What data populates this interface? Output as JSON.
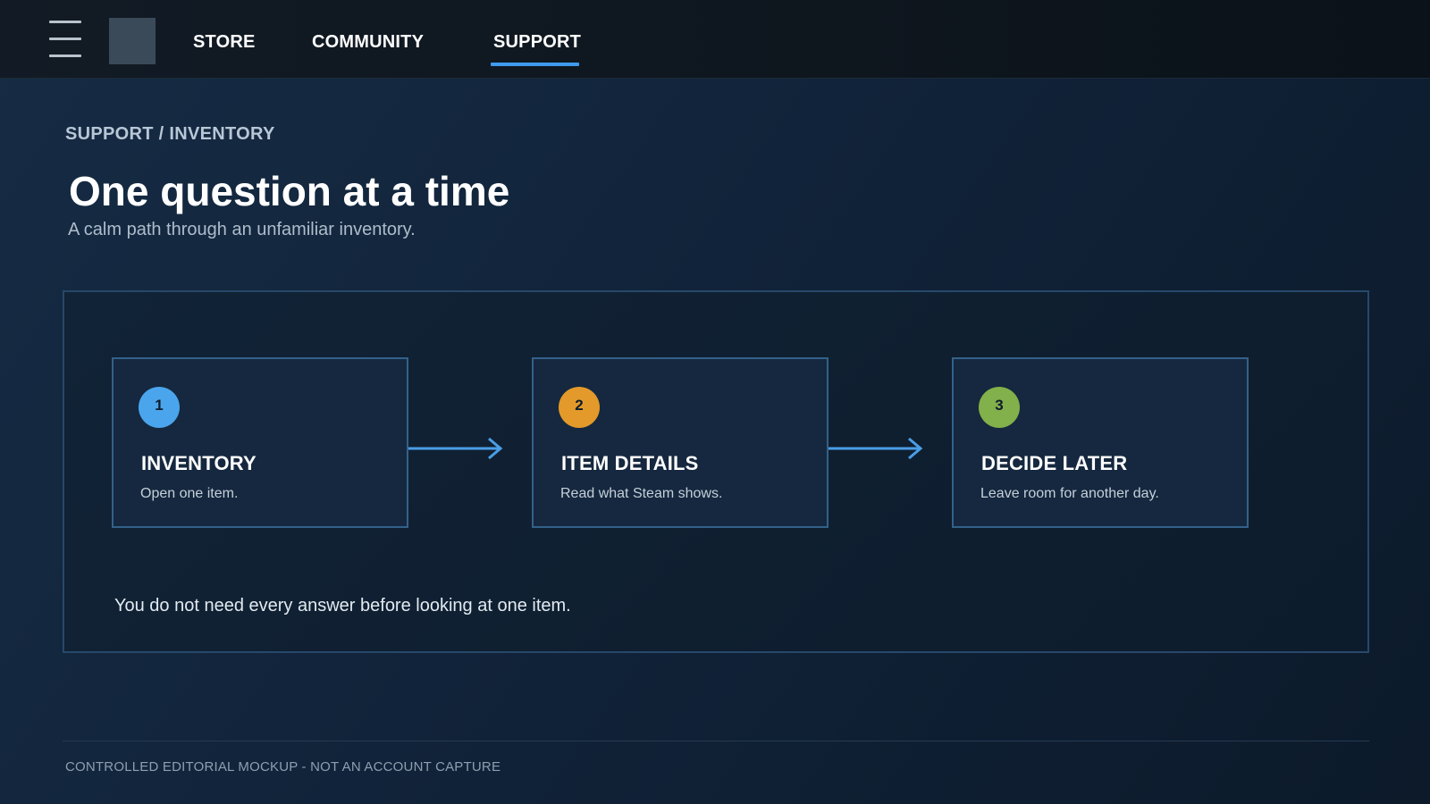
{
  "nav": {
    "tabs": [
      {
        "label": "STORE",
        "active": false
      },
      {
        "label": "COMMUNITY",
        "active": false
      },
      {
        "label": "SUPPORT",
        "active": true
      }
    ]
  },
  "header": {
    "breadcrumb": "SUPPORT / INVENTORY",
    "title": "One question at a time",
    "subtitle": "A calm path through an unfamiliar inventory."
  },
  "steps": [
    {
      "number": "1",
      "title": "INVENTORY",
      "description": "Open one item.",
      "color": "#4aa5ec"
    },
    {
      "number": "2",
      "title": "ITEM DETAILS",
      "description": "Read what Steam shows.",
      "color": "#e39a2a"
    },
    {
      "number": "3",
      "title": "DECIDE LATER",
      "description": "Leave room for another day.",
      "color": "#82b04a"
    }
  ],
  "note": "You do not need every answer before looking at one item.",
  "footer": "CONTROLLED EDITORIAL MOCKUP - NOT AN ACCOUNT CAPTURE",
  "colors": {
    "accent": "#3e9bee",
    "arrow": "#4a9ee6"
  }
}
